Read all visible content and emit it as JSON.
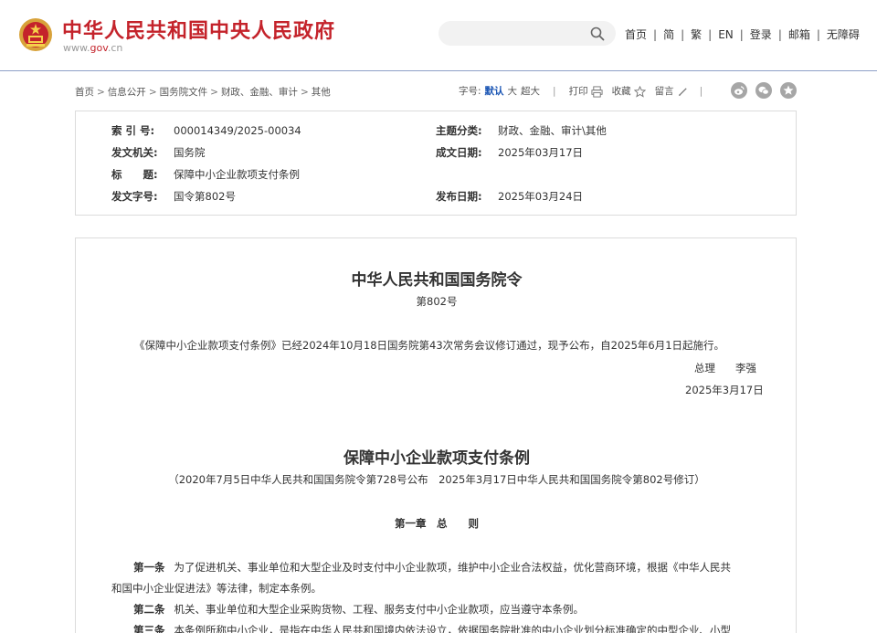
{
  "header": {
    "title": "中华人民共和国中央人民政府",
    "url_prefix": "www.",
    "url_brand": "gov",
    "url_suffix": ".cn",
    "search_placeholder": "",
    "nav": [
      "首页",
      "简",
      "繁",
      "EN",
      "登录",
      "邮箱",
      "无障碍"
    ]
  },
  "breadcrumb": [
    "首页",
    "信息公开",
    "国务院文件",
    "财政、金融、审计",
    "其他"
  ],
  "tools": {
    "font_label": "字号:",
    "font_default": "默认",
    "font_large": "大",
    "font_xlarge": "超大",
    "print": "打印",
    "favorite": "收藏",
    "comment": "留言"
  },
  "meta": {
    "index_label": "索 引 号:",
    "index_value": "000014349/2025-00034",
    "topic_label": "主题分类:",
    "topic_value": "财政、金融、审计\\其他",
    "issuer_label": "发文机关:",
    "issuer_value": "国务院",
    "created_label": "成文日期:",
    "created_value": "2025年03月17日",
    "title_label": "标　　题:",
    "title_value": "保障中小企业款项支付条例",
    "docno_label": "发文字号:",
    "docno_value": "国令第802号",
    "published_label": "发布日期:",
    "published_value": "2025年03月24日"
  },
  "document": {
    "order_title": "中华人民共和国国务院令",
    "order_no": "第802号",
    "announcement": "《保障中小企业款项支付条例》已经2024年10月18日国务院第43次常务会议修订通过，现予公布，自2025年6月1日起施行。",
    "signer_title": "总理",
    "signer_name": "李强",
    "sign_date": "2025年3月17日",
    "reg_title": "保障中小企业款项支付条例",
    "reg_history": "（2020年7月5日中华人民共和国国务院令第728号公布　2025年3月17日中华人民共和国国务院令第802号修订）",
    "chapter": "第一章　总　　则",
    "art1_label": "第一条",
    "art1_line1": "为了促进机关、事业单位和大型企业及时支付中小企业款项，维护中小企业合法权益，优化营商环境，根据《中华人民共",
    "art1_line2": "和国中小企业促进法》等法律，制定本条例。",
    "art2_label": "第二条",
    "art2_text": "机关、事业单位和大型企业采购货物、工程、服务支付中小企业款项，应当遵守本条例。",
    "art3_label": "第三条",
    "art3_text": "本条例所称中小企业，是指在中华人民共和国境内依法设立，依据国务院批准的中小企业划分标准确定的中型企业、小型"
  },
  "colors": {
    "brand_red": "#c4232b",
    "link_blue": "#1a55b4",
    "header_rule": "#8ea0c8"
  }
}
